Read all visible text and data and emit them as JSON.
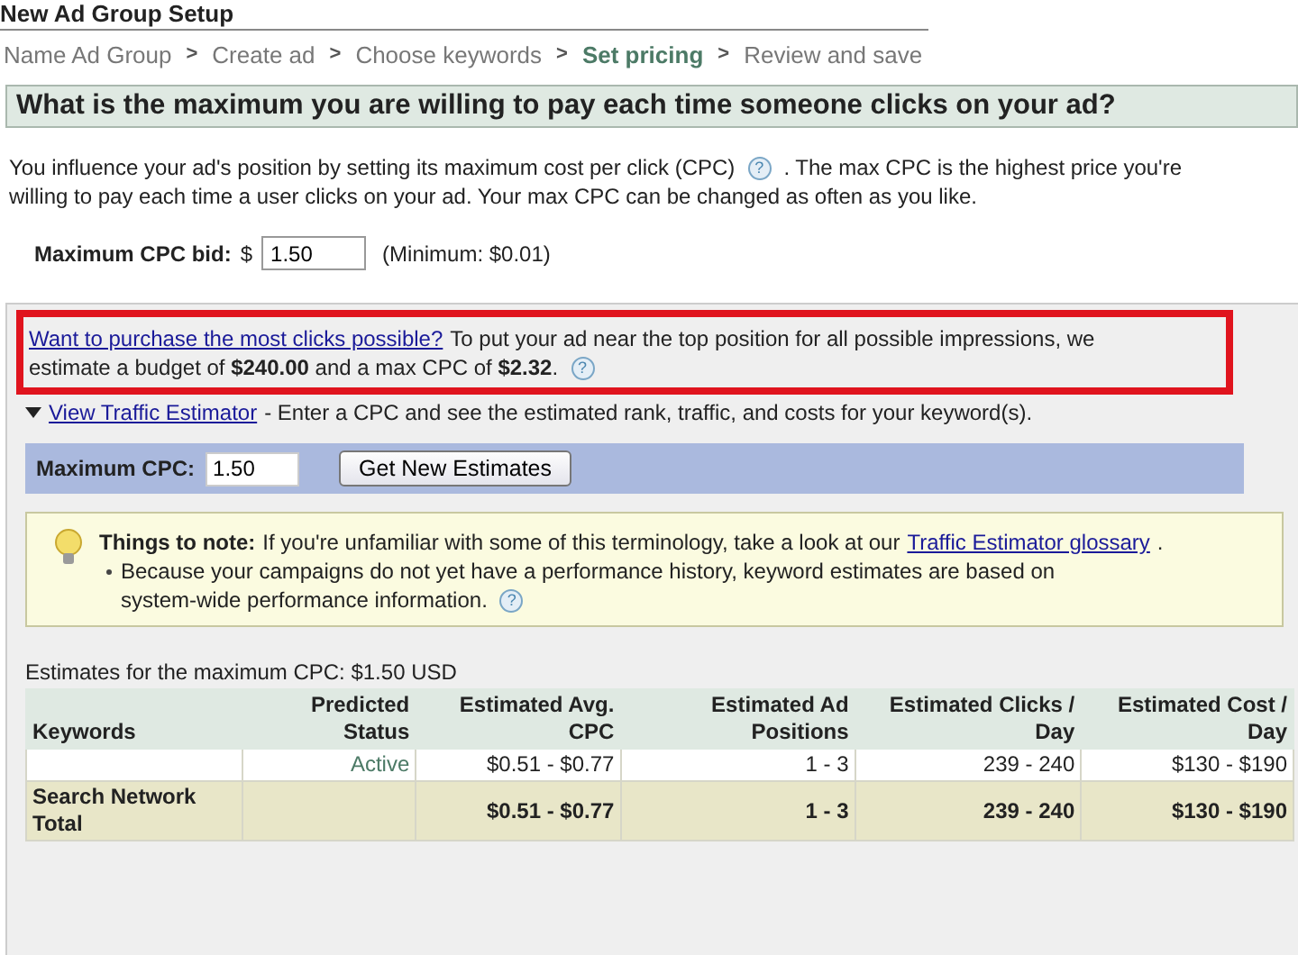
{
  "page_title": "New Ad Group Setup",
  "steps": [
    {
      "label": "Name Ad Group",
      "selected": false
    },
    {
      "label": "Create ad",
      "selected": false
    },
    {
      "label": "Choose keywords",
      "selected": false
    },
    {
      "label": "Set pricing",
      "selected": true
    },
    {
      "label": "Review and save",
      "selected": false
    }
  ],
  "step_separator": ">",
  "question": "What is the maximum you are willing to pay each time someone clicks on your ad?",
  "intro": {
    "before_help": "You influence your ad's position by setting its maximum cost per click (CPC)",
    "help_icon": "?",
    "after_help": ". The max CPC is the highest price you're",
    "line_2": "willing to pay each time a user clicks on your ad. Your max CPC can be changed as often as you like."
  },
  "bid": {
    "label": "Maximum CPC bid:",
    "currency": "$",
    "value": "1.50",
    "minimum": "(Minimum: $0.01)"
  },
  "suggestion": {
    "link": "Want to purchase the most clicks possible?",
    "line_1": "To put your ad near the top position for all possible impressions, we",
    "line_2": "estimate a budget of **$240.00** and a max CPC of **$2.32**.",
    "help_icon": "?",
    "highlighted": true
  },
  "estimator": {
    "expanded": true,
    "link": "View Traffic Estimator",
    "text": "- Enter a CPC and see the estimated rank, traffic, and costs for your keyword(s).",
    "cpc_label": "Maximum CPC:",
    "cpc_value": "1.50",
    "button": "Get New Estimates"
  },
  "note": {
    "title": "Things to note:",
    "text": "If you're unfamiliar with some of this terminology, take a look at our",
    "link": "Traffic Estimator glossary",
    "link_end": ".",
    "bullet_line_1": "Because your campaigns do not yet have a performance history, keyword estimates are based on",
    "bullet_line_2": "system-wide performance information.",
    "help_icon": "?"
  },
  "table": {
    "caption": "Estimates for the maximum CPC: $1.50 USD",
    "columns": [
      "Keywords",
      "Predicted Status",
      "Estimated Avg. CPC",
      "Estimated Ad Positions",
      "Estimated Clicks / Day",
      "Estimated Cost / Day"
    ],
    "rows": [
      {
        "kind": "keyword",
        "cells": [
          "",
          "Active",
          "$0.51 - $0.77",
          "1 - 3",
          "239 - 240",
          "$130 - $190"
        ]
      },
      {
        "kind": "total",
        "cells": [
          "Search Network Total",
          "",
          "$0.51 - $0.77",
          "1 - 3",
          "239 - 240",
          "$130 - $190"
        ]
      }
    ]
  }
}
